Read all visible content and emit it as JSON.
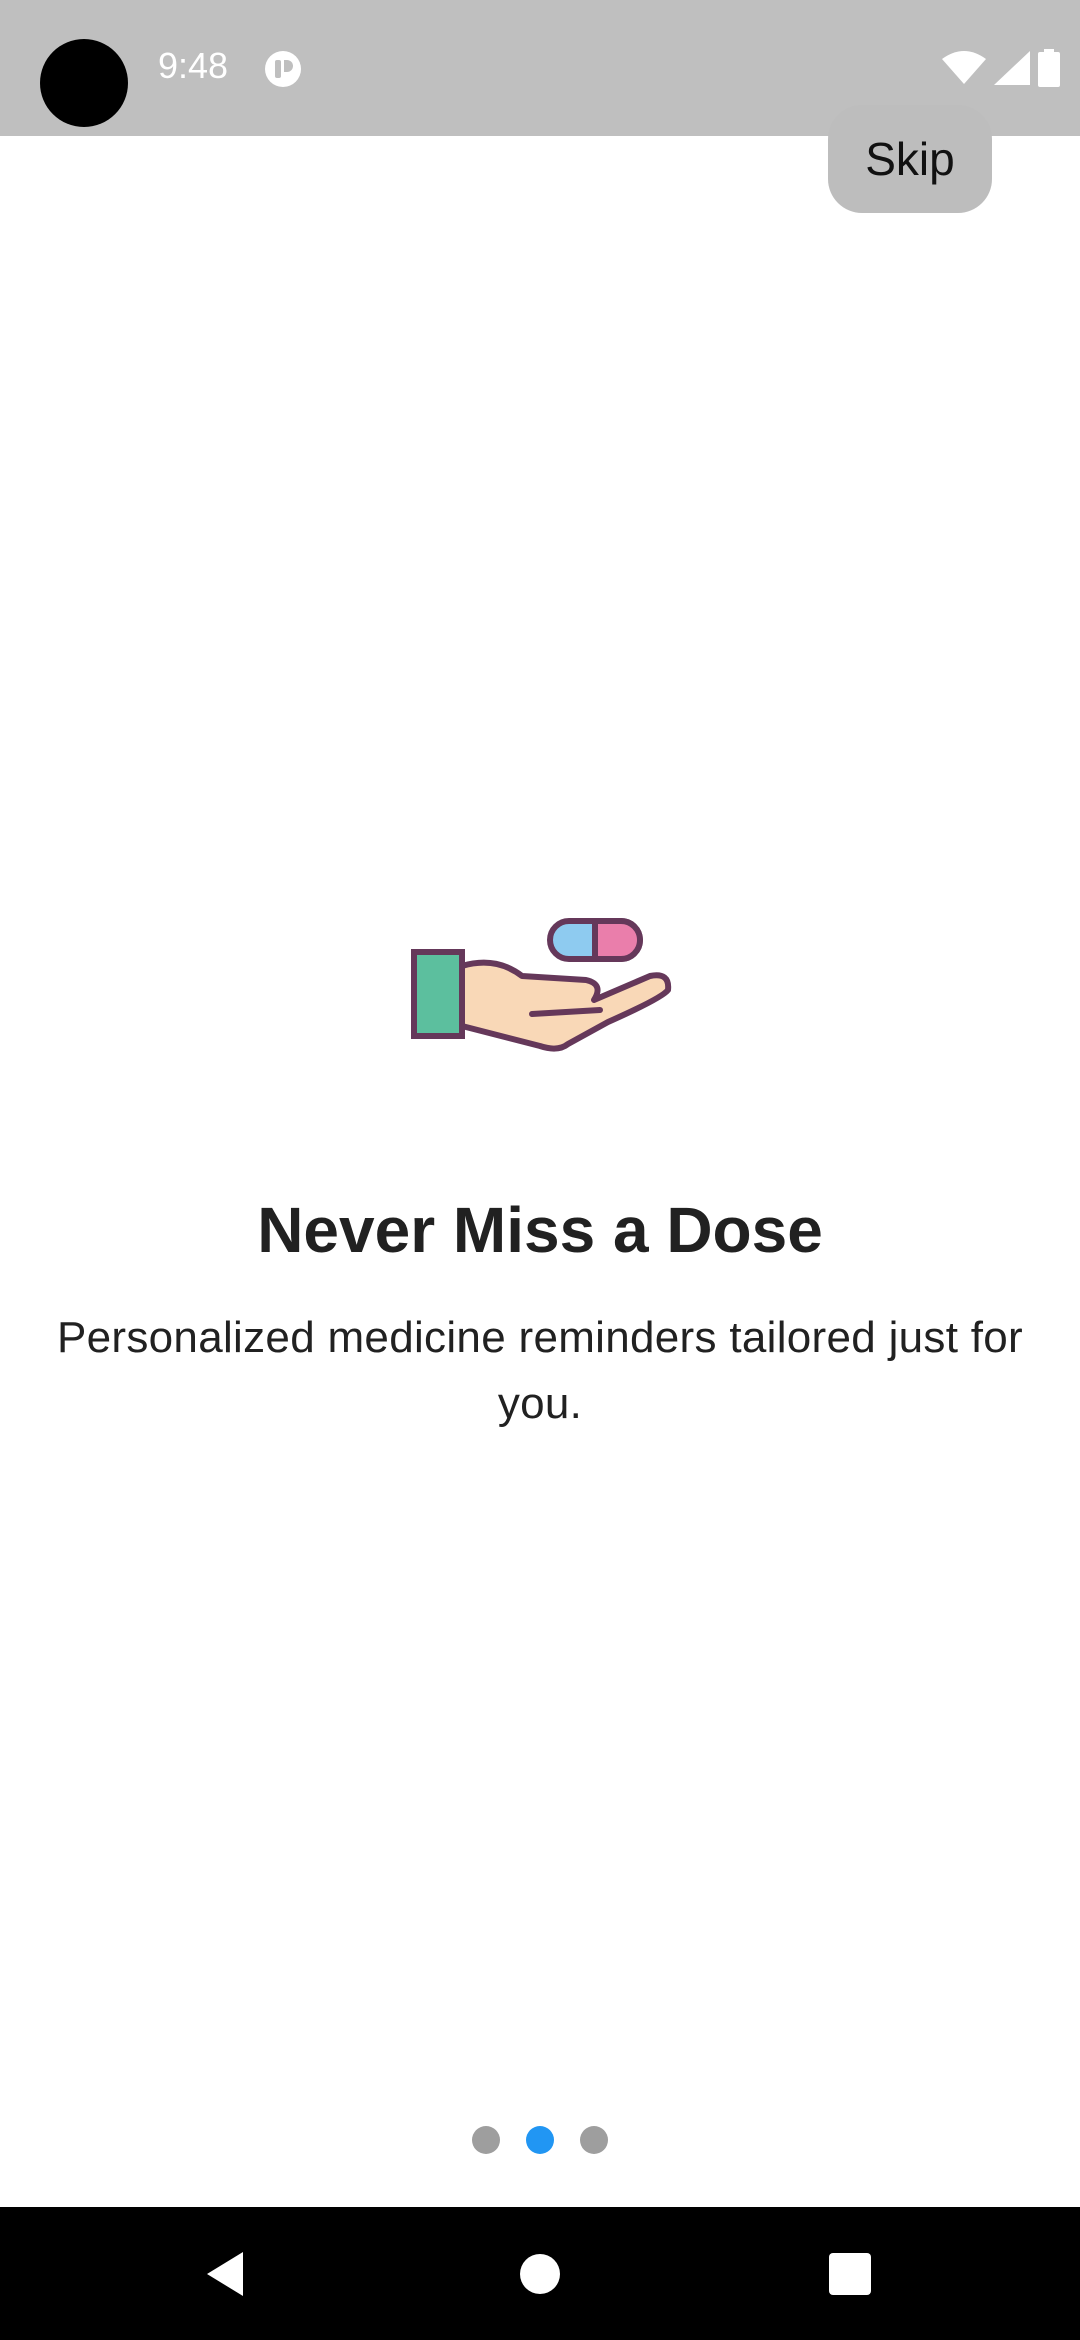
{
  "status_bar": {
    "time": "9:48",
    "icons": [
      "app-notification-icon",
      "wifi-icon",
      "signal-icon",
      "battery-icon"
    ]
  },
  "skip_label": "Skip",
  "onboarding": {
    "illustration": "hand-holding-pill-icon",
    "title": "Never Miss a Dose",
    "description": "Personalized medicine reminders tailored just for you.",
    "page_count": 3,
    "current_page": 2
  },
  "nav_bar": {
    "buttons": [
      "back-icon",
      "home-icon",
      "recents-icon"
    ]
  },
  "colors": {
    "status_bar": "#bfbfbf",
    "accent": "#2196f3",
    "inactive_dot": "#9e9e9e",
    "skip_button": "#bdbdbd",
    "text": "#212121"
  }
}
